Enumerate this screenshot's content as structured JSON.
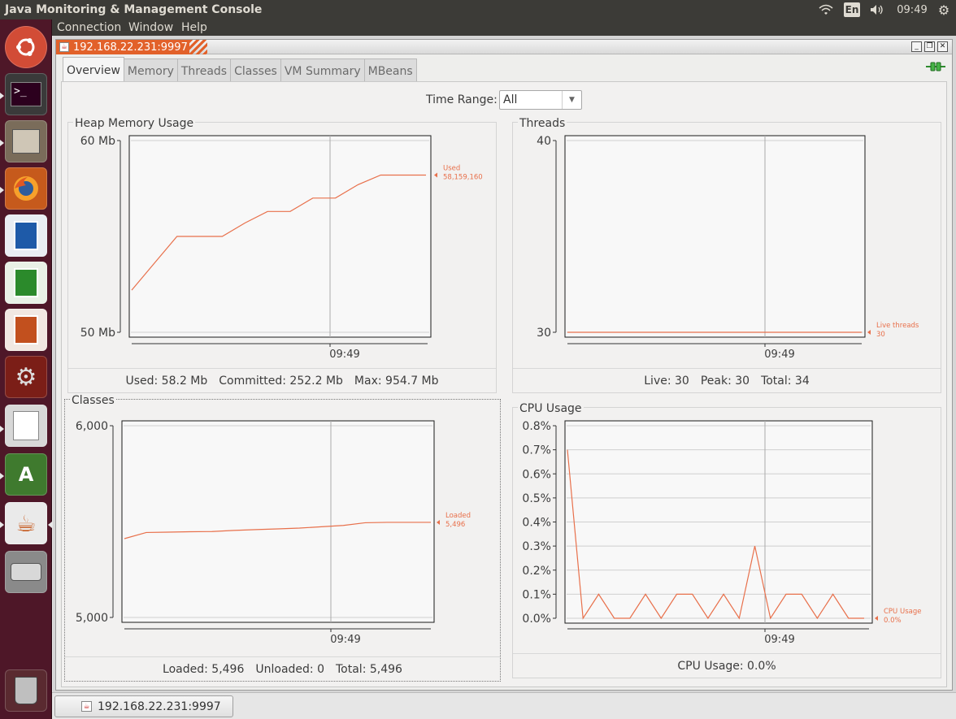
{
  "top_panel": {
    "app_title": "Java Monitoring & Management Console",
    "language": "En",
    "clock": "09:49"
  },
  "menubar": {
    "items": [
      {
        "label": "Connection",
        "underline": "C"
      },
      {
        "label": "Window",
        "underline": "W"
      },
      {
        "label": "Help",
        "underline": "H"
      }
    ]
  },
  "launcher": {
    "icons": [
      "ubuntu-dash-icon",
      "terminal-icon",
      "files-icon",
      "firefox-icon",
      "writer-icon",
      "calc-icon",
      "impress-icon",
      "system-settings-icon",
      "text-editor-icon",
      "software-updater-icon",
      "java-icon",
      "disk-icon",
      "trash-icon"
    ]
  },
  "internal_frame": {
    "title": "192.168.22.231:9997"
  },
  "tabs": [
    {
      "label": "Overview",
      "active": true
    },
    {
      "label": "Memory",
      "active": false
    },
    {
      "label": "Threads",
      "active": false
    },
    {
      "label": "Classes",
      "active": false
    },
    {
      "label": "VM Summary",
      "active": false
    },
    {
      "label": "MBeans",
      "active": false
    }
  ],
  "time_range": {
    "label": "Time Range:",
    "value": "All"
  },
  "panels": {
    "heap": {
      "title": "Heap Memory Usage",
      "footer": {
        "used": "Used: 58.2 Mb",
        "committed": "Committed: 252.2 Mb",
        "max": "Max: 954.7 Mb"
      }
    },
    "threads": {
      "title": "Threads",
      "footer": {
        "live": "Live: 30",
        "peak": "Peak: 30",
        "total": "Total: 34"
      }
    },
    "classes": {
      "title": "Classes",
      "footer": {
        "loaded": "Loaded: 5,496",
        "unloaded": "Unloaded: 0",
        "total": "Total: 5,496"
      }
    },
    "cpu": {
      "title": "CPU Usage",
      "footer": {
        "usage": "CPU Usage: 0.0%"
      }
    }
  },
  "chart_data": [
    {
      "type": "line",
      "title": "Heap Memory Usage",
      "yticks": [
        "60 Mb",
        "50 Mb"
      ],
      "ylim": [
        50,
        60
      ],
      "xtick": "09:49",
      "series": [
        {
          "name": "Used",
          "value_label": "58,159,160",
          "values": [
            52.2,
            53.6,
            55.0,
            55.0,
            55.0,
            55.7,
            56.3,
            56.3,
            57.0,
            57.0,
            57.7,
            58.2,
            58.2,
            58.2
          ]
        }
      ],
      "color": "#e8704b"
    },
    {
      "type": "line",
      "title": "Threads",
      "yticks": [
        "40",
        "30"
      ],
      "ylim": [
        30,
        40
      ],
      "xtick": "09:49",
      "series": [
        {
          "name": "Live threads",
          "value_label": "30",
          "values": [
            30,
            30,
            30,
            30,
            30,
            30,
            30,
            30,
            30,
            30,
            30,
            30,
            30,
            30
          ]
        }
      ],
      "color": "#e8704b"
    },
    {
      "type": "line",
      "title": "Classes",
      "yticks": [
        "6,000",
        "5,000"
      ],
      "ylim": [
        5000,
        6000
      ],
      "xtick": "09:49",
      "series": [
        {
          "name": "Loaded",
          "value_label": "5,496",
          "values": [
            5411,
            5443,
            5445,
            5447,
            5448,
            5454,
            5458,
            5462,
            5466,
            5473,
            5480,
            5494,
            5496,
            5496,
            5496
          ]
        }
      ],
      "color": "#e8704b"
    },
    {
      "type": "line",
      "title": "CPU Usage",
      "yticks": [
        "0.8%",
        "0.7%",
        "0.6%",
        "0.5%",
        "0.4%",
        "0.3%",
        "0.2%",
        "0.1%",
        "0.0%"
      ],
      "ylim": [
        0,
        0.8
      ],
      "xtick": "09:49",
      "series": [
        {
          "name": "CPU Usage",
          "value_label": "0.0%",
          "values": [
            0.7,
            0.0,
            0.1,
            0.0,
            0.0,
            0.1,
            0.0,
            0.1,
            0.1,
            0.0,
            0.1,
            0.0,
            0.3,
            0.0,
            0.1,
            0.1,
            0.0,
            0.1,
            0.0,
            0.0
          ]
        }
      ],
      "color": "#e8704b"
    }
  ],
  "taskbar": {
    "button_label": "192.168.22.231:9997"
  }
}
